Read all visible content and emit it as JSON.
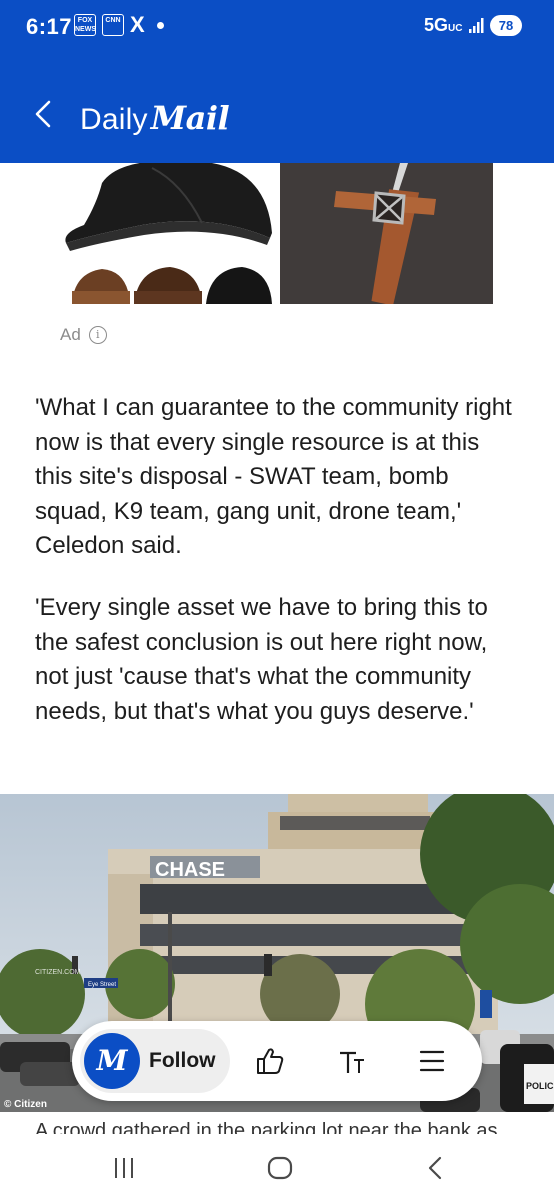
{
  "status_bar": {
    "time": "6:17",
    "notifications": [
      "fox-news-icon",
      "cnn-icon",
      "x-icon",
      "dot-icon"
    ],
    "fox_label": "FOX NEWS",
    "cnn_label": "CNN",
    "x_label": "X",
    "network": "5G",
    "network_sub": "UC",
    "battery": "78"
  },
  "app_bar": {
    "brand_daily": "Daily",
    "brand_mail": "Mail",
    "back_icon": "chevron-left-icon"
  },
  "ad": {
    "label": "Ad",
    "info_glyph": "i",
    "images": [
      "leather-caps-product-image",
      "copper-cross-pendant-image"
    ]
  },
  "article": {
    "paragraphs": [
      "'What I can guarantee to the community right now is that every single resource is at this this site's disposal - SWAT team, bomb squad, K9 team, gang unit, drone team,' Celedon said.",
      "'Every single asset we have to bring this to the safest conclusion is out here right now, not just 'cause that's what the community needs, but that's what you guys deserve.'"
    ]
  },
  "photo": {
    "building_sign": "CHASE",
    "street_sign": "Eye Street",
    "watermark": "CITIZEN.COM",
    "credit": "© Citizen",
    "police_text": "POLICE"
  },
  "toolbar": {
    "follow_logo": "M",
    "follow_label": "Follow",
    "icons": [
      "thumbs-up-icon",
      "text-size-icon",
      "menu-icon"
    ]
  },
  "below": {
    "peek": "A crowd gathered in the parking lot near the bank as the situation unfolded"
  },
  "nav": {
    "icons": [
      "recent-apps-icon",
      "home-icon",
      "back-icon"
    ]
  },
  "colors": {
    "brand_blue": "#0b4ec5",
    "text": "#1e1e1e",
    "ad_label": "#8b8b8b"
  }
}
